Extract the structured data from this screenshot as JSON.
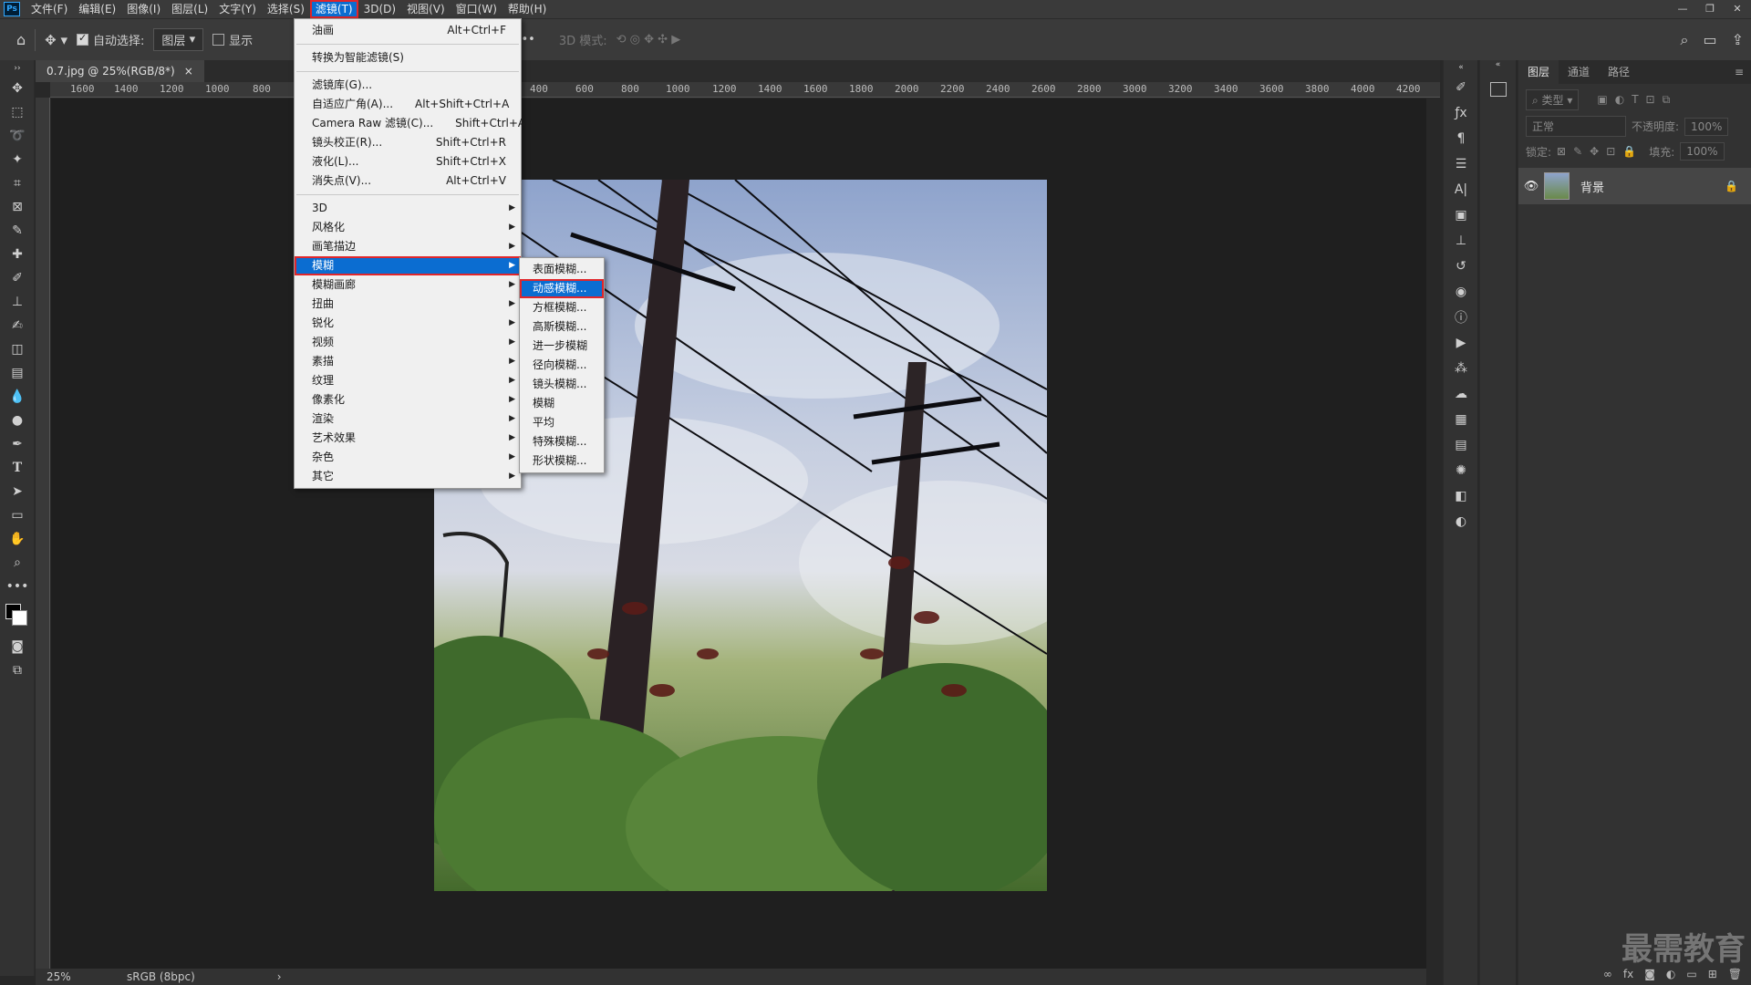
{
  "menubar": {
    "logo": "Ps",
    "items": [
      "文件(F)",
      "编辑(E)",
      "图像(I)",
      "图层(L)",
      "文字(Y)",
      "选择(S)",
      "滤镜(T)",
      "3D(D)",
      "视图(V)",
      "窗口(W)",
      "帮助(H)"
    ]
  },
  "options": {
    "auto_select_label": "自动选择:",
    "auto_select_value": "图层",
    "show_label": "显示",
    "mode_3d_label": "3D 模式:",
    "more": "•••"
  },
  "document": {
    "tab_title": "0.7.jpg @ 25%(RGB/8*)",
    "tab_close": "×"
  },
  "ruler_h": [
    "1600",
    "1400",
    "1200",
    "1000",
    "800",
    "400",
    "600",
    "800",
    "1000",
    "1200",
    "1400",
    "1600",
    "1800",
    "2000",
    "2200",
    "2400",
    "2600",
    "2800",
    "3000",
    "3200",
    "3400",
    "3600",
    "3800",
    "4000",
    "4200"
  ],
  "status": {
    "zoom": "25%",
    "profile": "sRGB (8bpc)",
    "arrow": "›"
  },
  "filter_menu": {
    "items": [
      {
        "label": "油画",
        "shortcut": "Alt+Ctrl+F"
      },
      {
        "sep": true
      },
      {
        "label": "转换为智能滤镜(S)",
        "shortcut": ""
      },
      {
        "sep": true
      },
      {
        "label": "滤镜库(G)...",
        "shortcut": ""
      },
      {
        "label": "自适应广角(A)...",
        "shortcut": "Alt+Shift+Ctrl+A"
      },
      {
        "label": "Camera Raw 滤镜(C)...",
        "shortcut": "Shift+Ctrl+A"
      },
      {
        "label": "镜头校正(R)...",
        "shortcut": "Shift+Ctrl+R"
      },
      {
        "label": "液化(L)...",
        "shortcut": "Shift+Ctrl+X"
      },
      {
        "label": "消失点(V)...",
        "shortcut": "Alt+Ctrl+V"
      },
      {
        "sep": true
      },
      {
        "label": "3D",
        "sub": true
      },
      {
        "label": "风格化",
        "sub": true
      },
      {
        "label": "画笔描边",
        "sub": true
      },
      {
        "label": "模糊",
        "sub": true,
        "hl": true
      },
      {
        "label": "模糊画廊",
        "sub": true
      },
      {
        "label": "扭曲",
        "sub": true
      },
      {
        "label": "锐化",
        "sub": true
      },
      {
        "label": "视频",
        "sub": true
      },
      {
        "label": "素描",
        "sub": true
      },
      {
        "label": "纹理",
        "sub": true
      },
      {
        "label": "像素化",
        "sub": true
      },
      {
        "label": "渲染",
        "sub": true
      },
      {
        "label": "艺术效果",
        "sub": true
      },
      {
        "label": "杂色",
        "sub": true
      },
      {
        "label": "其它",
        "sub": true
      }
    ]
  },
  "blur_submenu": {
    "items": [
      {
        "label": "表面模糊..."
      },
      {
        "label": "动感模糊...",
        "hl": true
      },
      {
        "label": "方框模糊..."
      },
      {
        "label": "高斯模糊..."
      },
      {
        "label": "进一步模糊"
      },
      {
        "label": "径向模糊..."
      },
      {
        "label": "镜头模糊..."
      },
      {
        "label": "模糊"
      },
      {
        "label": "平均"
      },
      {
        "label": "特殊模糊..."
      },
      {
        "label": "形状模糊..."
      }
    ]
  },
  "layers_panel": {
    "tabs": [
      "图层",
      "通道",
      "路径"
    ],
    "kind_placeholder": "类型",
    "blend_mode": "正常",
    "opacity_label": "不透明度:",
    "opacity_value": "100%",
    "lock_label": "锁定:",
    "fill_label": "填充:",
    "fill_value": "100%",
    "layer_name": "背景"
  },
  "watermark": "最需教育",
  "colors": {
    "accent": "#0b6dd1",
    "highlight_border": "#e0262b"
  }
}
